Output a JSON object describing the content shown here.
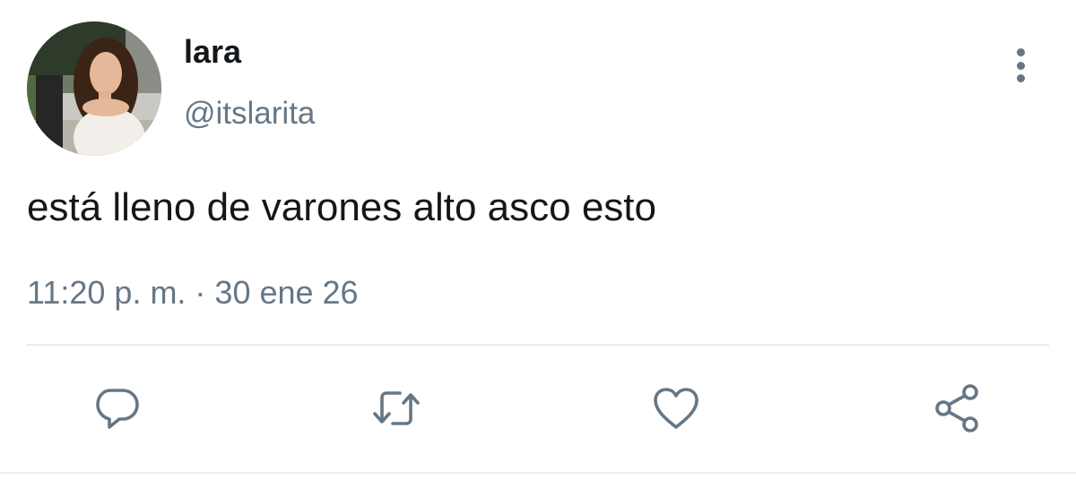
{
  "tweet": {
    "display_name": "lara",
    "handle": "@itslarita",
    "text": "está lleno de varones alto asco esto",
    "timestamp": "11:20 p. m. · 30 ene 26"
  },
  "actions": [
    {
      "name": "reply",
      "icon": "reply-icon"
    },
    {
      "name": "retweet",
      "icon": "retweet-icon"
    },
    {
      "name": "like",
      "icon": "heart-icon"
    },
    {
      "name": "share",
      "icon": "share-icon"
    }
  ],
  "colors": {
    "text_primary": "#14171a",
    "text_secondary": "#657786",
    "icon": "#657786",
    "divider": "#e6ecf0",
    "background": "#ffffff"
  }
}
